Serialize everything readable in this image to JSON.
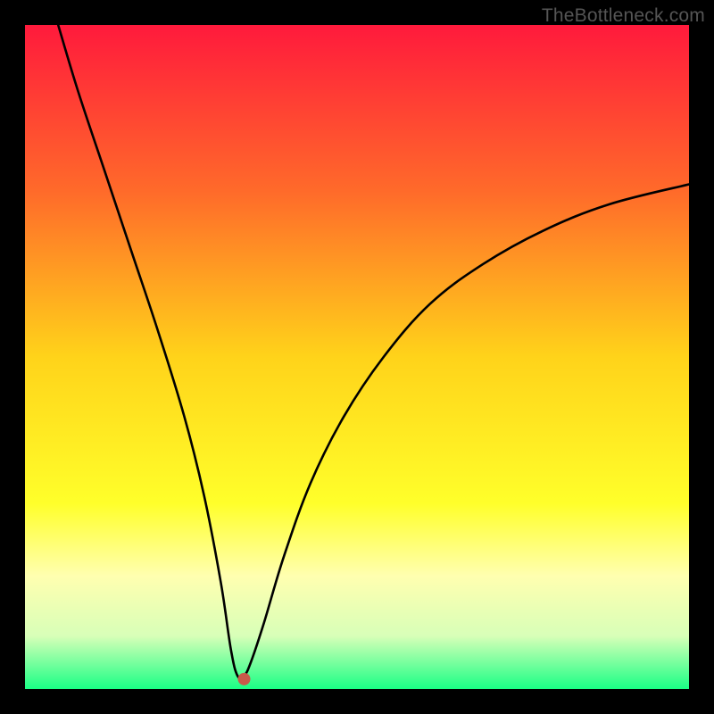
{
  "watermark": "TheBottleneck.com",
  "chart_data": {
    "type": "line",
    "title": "",
    "xlabel": "",
    "ylabel": "",
    "xlim": [
      0,
      100
    ],
    "ylim": [
      0,
      100
    ],
    "gradient_stops": [
      {
        "offset": 0,
        "color": "#ff1a3c"
      },
      {
        "offset": 25,
        "color": "#ff6a2a"
      },
      {
        "offset": 50,
        "color": "#ffd31a"
      },
      {
        "offset": 72,
        "color": "#ffff2a"
      },
      {
        "offset": 83,
        "color": "#ffffb0"
      },
      {
        "offset": 92,
        "color": "#d8ffb8"
      },
      {
        "offset": 100,
        "color": "#1aff85"
      }
    ],
    "series": [
      {
        "name": "bottleneck-curve",
        "x": [
          5,
          8,
          12,
          16,
          20,
          24,
          27,
          29.5,
          31,
          32,
          33,
          34,
          36,
          39,
          43,
          48,
          54,
          61,
          69,
          78,
          88,
          100
        ],
        "y": [
          100,
          90,
          78,
          66,
          54,
          41,
          29,
          16,
          6,
          2,
          2,
          4,
          10,
          20,
          31,
          41,
          50,
          58,
          64,
          69,
          73,
          76
        ]
      }
    ],
    "annotations": [
      {
        "type": "point",
        "name": "min-marker",
        "x": 33,
        "y": 1.5,
        "color": "#c95a4a",
        "radius_px": 7
      }
    ]
  }
}
